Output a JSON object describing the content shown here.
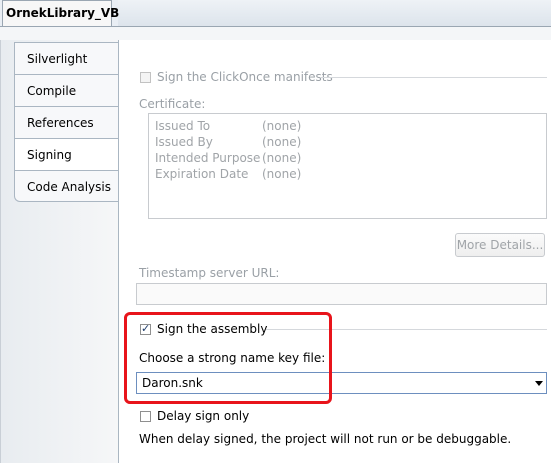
{
  "document_tab": {
    "label": "OrnekLibrary_VB"
  },
  "sidebar": {
    "items": [
      {
        "label": "Silverlight"
      },
      {
        "label": "Compile"
      },
      {
        "label": "References"
      },
      {
        "label": "Signing",
        "selected": true
      },
      {
        "label": "Code Analysis"
      }
    ]
  },
  "signing": {
    "clickonce_label": "Sign the ClickOnce manifests",
    "certificate_label": "Certificate:",
    "certificate": [
      {
        "key": "Issued To",
        "value": "(none)"
      },
      {
        "key": "Issued By",
        "value": "(none)"
      },
      {
        "key": "Intended Purpose",
        "value": "(none)"
      },
      {
        "key": "Expiration Date",
        "value": "(none)"
      }
    ],
    "more_details_label": "More Details...",
    "timestamp_label": "Timestamp server URL:",
    "timestamp_value": "",
    "sign_assembly_label": "Sign the assembly",
    "sign_assembly_checked": true,
    "key_file_label": "Choose a strong name key file:",
    "key_file_value": "Daron.snk",
    "delay_sign_label": "Delay sign only",
    "delay_sign_checked": false,
    "delay_note": "When delay signed, the project will not run or be debuggable."
  },
  "colors": {
    "highlight": "#e8141b",
    "selected_tab": "#ffffff"
  }
}
